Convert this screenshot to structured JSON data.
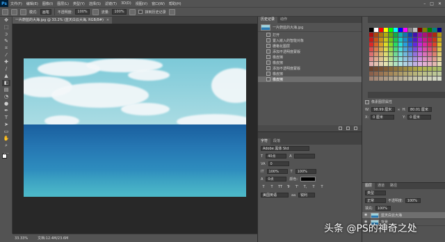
{
  "app": {
    "logo": "Ps"
  },
  "menubar": {
    "items": [
      "文件(F)",
      "编辑(E)",
      "图像(I)",
      "图层(L)",
      "类型(Y)",
      "选择(S)",
      "滤镜(T)",
      "3D(D)",
      "视图(V)",
      "窗口(W)",
      "帮助(H)"
    ]
  },
  "options": {
    "mode_label": "模式:",
    "mode_value": "画笔",
    "opacity_label": "不透明度:",
    "opacity_value": "100%",
    "flow_label": "流量:",
    "flow_value": "100%",
    "history_label": "抹到历史记录"
  },
  "document": {
    "tab_title": "一片蔚蓝的大海.jpg @ 33.2% (蓝天白云大海, RGB/8#)",
    "close_icon": "×"
  },
  "status": {
    "zoom": "33.33%",
    "doc_info": "文档:12.4M/23.6M"
  },
  "history": {
    "tabs": [
      "历史记录",
      "动作"
    ],
    "snapshot": "一片蔚蓝的大海.jpg",
    "items": [
      "打开",
      "置入嵌入的智能对象",
      "栅格化图层",
      "添加不透明度蒙版",
      "橡皮擦",
      "橡皮擦",
      "添加不透明度蒙版",
      "橡皮擦",
      "橡皮擦"
    ],
    "active_index": 8
  },
  "character": {
    "tabs": [
      "字符",
      "段落"
    ],
    "font": "Adobe 黑体 Std",
    "size": "40点",
    "leading": "",
    "tracking": "0",
    "vscale": "100%",
    "hscale": "100%",
    "baseline": "0点",
    "color_label": "颜色:",
    "styles": [
      "T",
      "T",
      "TT",
      "Tr",
      "T'",
      "T,",
      "T",
      "T"
    ],
    "language": "美国英语",
    "aa": "锐利"
  },
  "properties": {
    "title": "像素图层属性",
    "w_label": "W:",
    "w_value": "98.99 厘米",
    "h_label": "H:",
    "h_value": "80.01 厘米",
    "x_label": "X:",
    "x_value": "0 厘米",
    "y_label": "Y:",
    "y_value": "0 厘米"
  },
  "layers": {
    "tabs": [
      "图层",
      "通道",
      "路径"
    ],
    "kind": "类型",
    "blend": "正常",
    "opacity_label": "不透明度:",
    "opacity": "100%",
    "fill_label": "填充:",
    "fill": "100%",
    "items": [
      {
        "name": "蓝天白云大海",
        "active": true
      },
      {
        "name": "背景",
        "active": false
      }
    ]
  },
  "watermark": "头条 @PS的神奇之处",
  "colors": {
    "bg": "#535353",
    "panel_dark": "#424242",
    "canvas_bg": "#282828",
    "fg_swatch": "#fdfdfd",
    "bg_swatch": "#b48cc8"
  }
}
